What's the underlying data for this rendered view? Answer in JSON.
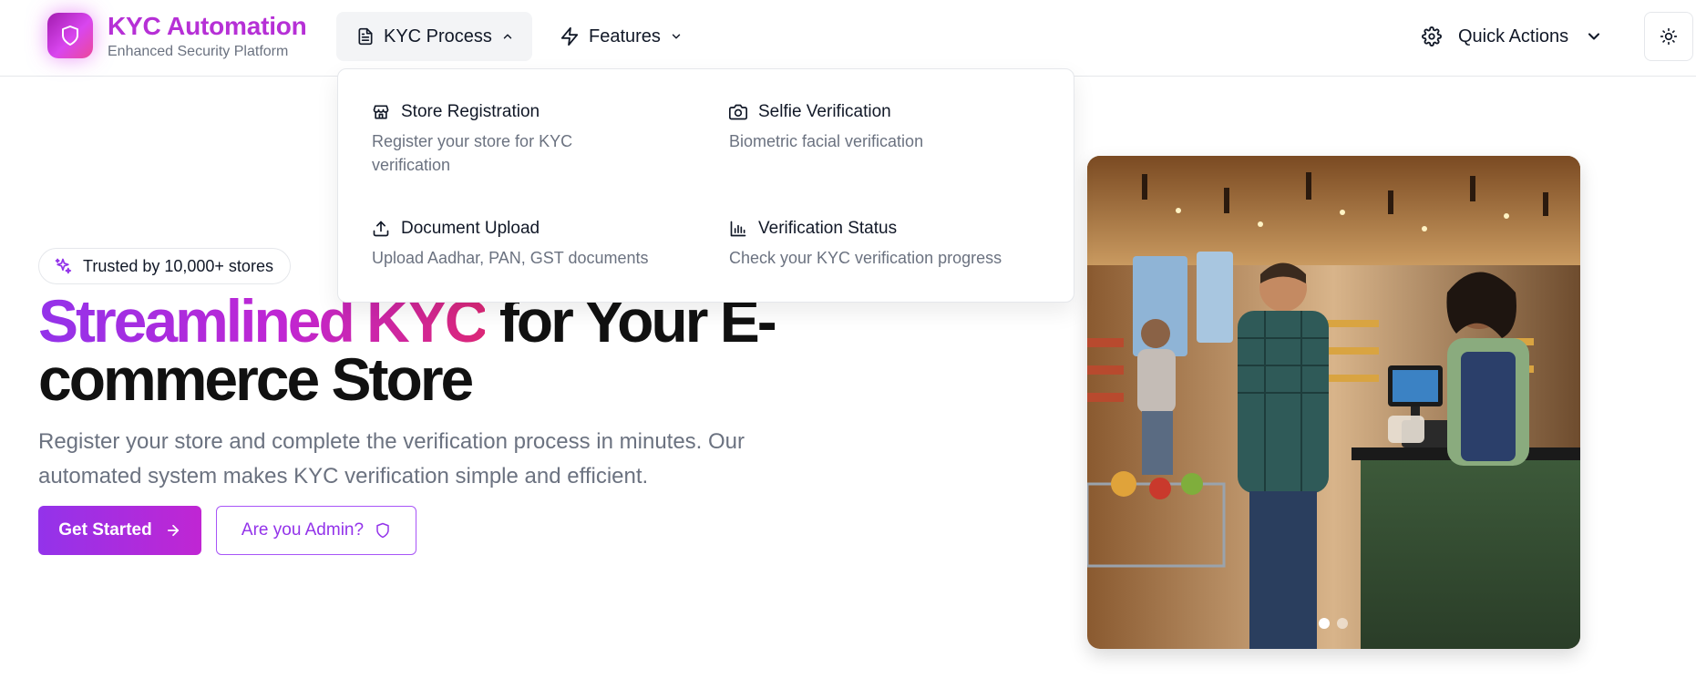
{
  "brand": {
    "title": "KYC Automation",
    "subtitle": "Enhanced Security Platform",
    "logo_icon": "shield-icon"
  },
  "nav": {
    "kyc_process": {
      "label": "KYC Process",
      "icon": "file-text-icon",
      "state": "expanded"
    },
    "features": {
      "label": "Features",
      "icon": "zap-icon"
    },
    "quick_actions": {
      "label": "Quick Actions",
      "icon": "gear-icon"
    },
    "theme_toggle": {
      "icon": "sun-icon"
    }
  },
  "dropdown": {
    "items": [
      {
        "title": "Store Registration",
        "description": "Register your store for KYC verification",
        "icon": "store-icon"
      },
      {
        "title": "Selfie Verification",
        "description": "Biometric facial verification",
        "icon": "camera-icon"
      },
      {
        "title": "Document Upload",
        "description": "Upload Aadhar, PAN, GST documents",
        "icon": "upload-icon"
      },
      {
        "title": "Verification Status",
        "description": "Check your KYC verification progress",
        "icon": "bar-chart-icon"
      }
    ]
  },
  "hero": {
    "badge": "Trusted by 10,000+ stores",
    "headline_highlight": "Streamlined KYC",
    "headline_rest": " for Your E-commerce Store",
    "subtext": "Register your store and complete the verification process in minutes. Our automated system makes KYC verification simple and efficient.",
    "primary_button": "Get Started",
    "secondary_button": "Are you Admin?"
  },
  "carousel": {
    "slide_count": 2,
    "active_index": 0
  },
  "colors": {
    "brand": "#b630d6",
    "gradient_start": "#9333ea",
    "gradient_end": "#db2777",
    "muted_text": "#6b7280"
  }
}
